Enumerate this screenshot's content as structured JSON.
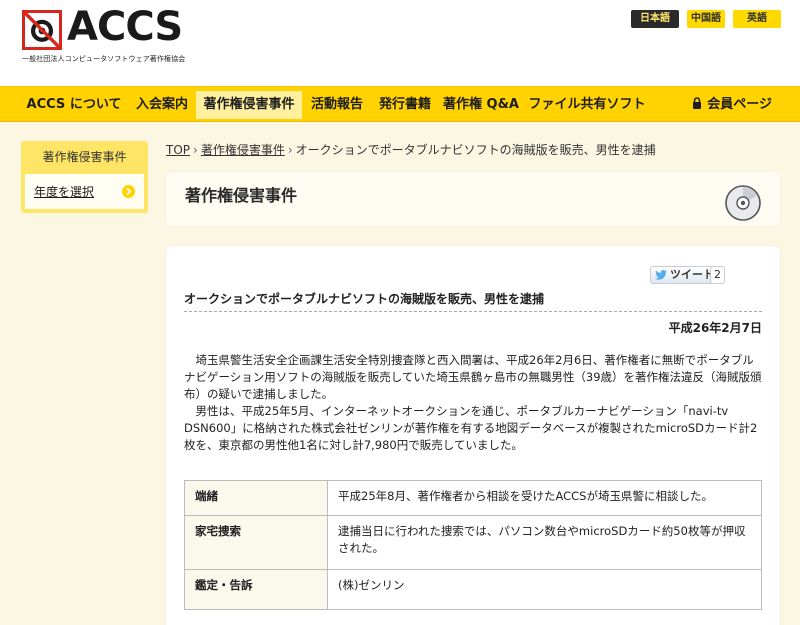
{
  "header": {
    "logo_text": "ACCS",
    "logo_subtitle": "一般社団法人コンピュータソフトウェア著作権協会",
    "languages": [
      "日本語",
      "中国語",
      "英語"
    ]
  },
  "nav": {
    "items": [
      "ACCS について",
      "入会案内",
      "著作権侵害事件",
      "活動報告",
      "発行書籍",
      "著作権 Q&A",
      "ファイル共有ソフト"
    ],
    "member": "会員ページ"
  },
  "sidebar": {
    "title": "著作権侵害事件",
    "item": "年度を選択"
  },
  "breadcrumb": {
    "top": "TOP",
    "section": "著作権侵害事件",
    "current": "オークションでポータブルナビソフトの海賊版を販売、男性を逮捕"
  },
  "page_title": "著作権侵害事件",
  "share": {
    "tweet_label": "ツイート",
    "tweet_count": "2"
  },
  "article": {
    "title": "オークションでポータブルナビソフトの海賊版を販売、男性を逮捕",
    "date": "平成26年2月7日",
    "paragraphs": [
      "埼玉県警生活安全企画課生活安全特別捜査隊と西入間署は、平成26年2月6日、著作権者に無断でポータブルナビゲーション用ソフトの海賊版を販売していた埼玉県鶴ヶ島市の無職男性（39歳）を著作権法違反（海賊版頒布）の疑いで逮捕しました。",
      "男性は、平成25年5月、インターネットオークションを通じ、ポータブルカーナビゲーション「navi-tv DSN600」に格納された株式会社ゼンリンが著作権を有する地図データベースが複製されたmicroSDカード計2枚を、東京都の男性他1名に対し計7,980円で販売していました。"
    ],
    "table": [
      {
        "label": "端緒",
        "value": "平成25年8月、著作権者から相談を受けたACCSが埼玉県警に相談した。"
      },
      {
        "label": "家宅捜索",
        "value": "逮捕当日に行われた捜索では、パソコン数台やmicroSDカード約50枚等が押収された。"
      },
      {
        "label": "鑑定・告訴",
        "value": "(株)ゼンリン"
      }
    ]
  },
  "colors": {
    "accent_yellow": "#ffd200",
    "background": "#fcf7e3",
    "logo_red": "#d8261c"
  }
}
